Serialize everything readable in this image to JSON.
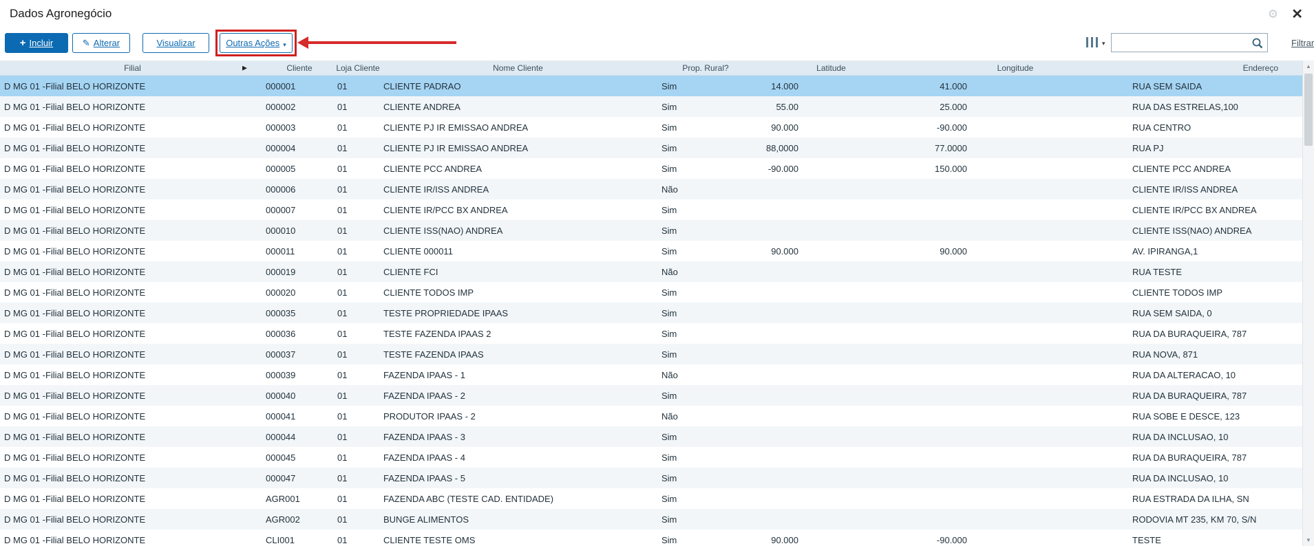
{
  "window": {
    "title": "Dados Agronegócio"
  },
  "glyphs": {
    "plus": "+",
    "pencil": "✎",
    "caret_down": "▾",
    "gear": "⚙",
    "close": "✕",
    "sort": "▶",
    "up": "▲",
    "down": "▼"
  },
  "toolbar": {
    "incluir": "Incluir",
    "alterar": "Alterar",
    "visualizar": "Visualizar",
    "outras_acoes": "Outras Ações",
    "search_value": "",
    "filtrar": "Filtrar"
  },
  "annotation": {
    "color": "#d11f1f",
    "target": "Outras Ações"
  },
  "table": {
    "selected_index": 0,
    "columns": [
      "Filial",
      "Cliente",
      "Loja Cliente",
      "Nome Cliente",
      "Prop. Rural?",
      "Latitude",
      "Longitude",
      "Endereço"
    ],
    "rows": [
      {
        "filial": "D MG 01 -Filial BELO HORIZONTE",
        "cliente": "000001",
        "loja": "01",
        "nome": "CLIENTE PADRAO",
        "prop": "Sim",
        "lat": "14.000",
        "lng": "41.000",
        "end": "RUA SEM SAIDA"
      },
      {
        "filial": "D MG 01 -Filial BELO HORIZONTE",
        "cliente": "000002",
        "loja": "01",
        "nome": "CLIENTE ANDREA",
        "prop": "Sim",
        "lat": "55.00",
        "lng": "25.000",
        "end": "RUA DAS ESTRELAS,100"
      },
      {
        "filial": "D MG 01 -Filial BELO HORIZONTE",
        "cliente": "000003",
        "loja": "01",
        "nome": "CLIENTE PJ IR EMISSAO ANDREA",
        "prop": "Sim",
        "lat": "90.000",
        "lng": "-90.000",
        "end": "RUA CENTRO"
      },
      {
        "filial": "D MG 01 -Filial BELO HORIZONTE",
        "cliente": "000004",
        "loja": "01",
        "nome": "CLIENTE PJ IR EMISSAO ANDREA",
        "prop": "Sim",
        "lat": "88,0000",
        "lng": "77.0000",
        "end": "RUA PJ"
      },
      {
        "filial": "D MG 01 -Filial BELO HORIZONTE",
        "cliente": "000005",
        "loja": "01",
        "nome": "CLIENTE PCC ANDREA",
        "prop": "Sim",
        "lat": "-90.000",
        "lng": "150.000",
        "end": "CLIENTE PCC ANDREA"
      },
      {
        "filial": "D MG 01 -Filial BELO HORIZONTE",
        "cliente": "000006",
        "loja": "01",
        "nome": "CLIENTE IR/ISS ANDREA",
        "prop": "Não",
        "lat": "",
        "lng": "",
        "end": "CLIENTE IR/ISS ANDREA"
      },
      {
        "filial": "D MG 01 -Filial BELO HORIZONTE",
        "cliente": "000007",
        "loja": "01",
        "nome": "CLIENTE IR/PCC BX ANDREA",
        "prop": "Sim",
        "lat": "",
        "lng": "",
        "end": "CLIENTE IR/PCC BX ANDREA"
      },
      {
        "filial": "D MG 01 -Filial BELO HORIZONTE",
        "cliente": "000010",
        "loja": "01",
        "nome": "CLIENTE ISS(NAO) ANDREA",
        "prop": "Sim",
        "lat": "",
        "lng": "",
        "end": "CLIENTE ISS(NAO) ANDREA"
      },
      {
        "filial": "D MG 01 -Filial BELO HORIZONTE",
        "cliente": "000011",
        "loja": "01",
        "nome": "CLIENTE 000011",
        "prop": "Sim",
        "lat": "90.000",
        "lng": "90.000",
        "end": "AV. IPIRANGA,1"
      },
      {
        "filial": "D MG 01 -Filial BELO HORIZONTE",
        "cliente": "000019",
        "loja": "01",
        "nome": "CLIENTE FCI",
        "prop": "Não",
        "lat": "",
        "lng": "",
        "end": "RUA TESTE"
      },
      {
        "filial": "D MG 01 -Filial BELO HORIZONTE",
        "cliente": "000020",
        "loja": "01",
        "nome": "CLIENTE TODOS IMP",
        "prop": "Sim",
        "lat": "",
        "lng": "",
        "end": "CLIENTE TODOS IMP"
      },
      {
        "filial": "D MG 01 -Filial BELO HORIZONTE",
        "cliente": "000035",
        "loja": "01",
        "nome": "TESTE PROPRIEDADE IPAAS",
        "prop": "Sim",
        "lat": "",
        "lng": "",
        "end": "RUA SEM SAIDA, 0"
      },
      {
        "filial": "D MG 01 -Filial BELO HORIZONTE",
        "cliente": "000036",
        "loja": "01",
        "nome": "TESTE FAZENDA IPAAS 2",
        "prop": "Sim",
        "lat": "",
        "lng": "",
        "end": "RUA DA BURAQUEIRA, 787"
      },
      {
        "filial": "D MG 01 -Filial BELO HORIZONTE",
        "cliente": "000037",
        "loja": "01",
        "nome": "TESTE FAZENDA IPAAS",
        "prop": "Sim",
        "lat": "",
        "lng": "",
        "end": "RUA NOVA, 871"
      },
      {
        "filial": "D MG 01 -Filial BELO HORIZONTE",
        "cliente": "000039",
        "loja": "01",
        "nome": "FAZENDA IPAAS - 1",
        "prop": "Não",
        "lat": "",
        "lng": "",
        "end": "RUA DA ALTERACAO, 10"
      },
      {
        "filial": "D MG 01 -Filial BELO HORIZONTE",
        "cliente": "000040",
        "loja": "01",
        "nome": "FAZENDA IPAAS - 2",
        "prop": "Sim",
        "lat": "",
        "lng": "",
        "end": "RUA DA BURAQUEIRA, 787"
      },
      {
        "filial": "D MG 01 -Filial BELO HORIZONTE",
        "cliente": "000041",
        "loja": "01",
        "nome": "PRODUTOR IPAAS - 2",
        "prop": "Não",
        "lat": "",
        "lng": "",
        "end": "RUA SOBE E DESCE, 123"
      },
      {
        "filial": "D MG 01 -Filial BELO HORIZONTE",
        "cliente": "000044",
        "loja": "01",
        "nome": "FAZENDA IPAAS - 3",
        "prop": "Sim",
        "lat": "",
        "lng": "",
        "end": "RUA DA INCLUSAO, 10"
      },
      {
        "filial": "D MG 01 -Filial BELO HORIZONTE",
        "cliente": "000045",
        "loja": "01",
        "nome": "FAZENDA IPAAS - 4",
        "prop": "Sim",
        "lat": "",
        "lng": "",
        "end": "RUA DA BURAQUEIRA, 787"
      },
      {
        "filial": "D MG 01 -Filial BELO HORIZONTE",
        "cliente": "000047",
        "loja": "01",
        "nome": "FAZENDA IPAAS - 5",
        "prop": "Sim",
        "lat": "",
        "lng": "",
        "end": "RUA DA INCLUSAO, 10"
      },
      {
        "filial": "D MG 01 -Filial BELO HORIZONTE",
        "cliente": "AGR001",
        "loja": "01",
        "nome": "FAZENDA ABC (TESTE CAD. ENTIDADE)",
        "prop": "Sim",
        "lat": "",
        "lng": "",
        "end": "RUA ESTRADA DA ILHA, SN"
      },
      {
        "filial": "D MG 01 -Filial BELO HORIZONTE",
        "cliente": "AGR002",
        "loja": "01",
        "nome": "BUNGE ALIMENTOS",
        "prop": "Sim",
        "lat": "",
        "lng": "",
        "end": "RODOVIA MT 235, KM 70, S/N"
      },
      {
        "filial": "D MG 01 -Filial BELO HORIZONTE",
        "cliente": "CLI001",
        "loja": "01",
        "nome": "CLIENTE TESTE OMS",
        "prop": "Sim",
        "lat": "90.000",
        "lng": "-90.000",
        "end": "TESTE"
      }
    ]
  }
}
